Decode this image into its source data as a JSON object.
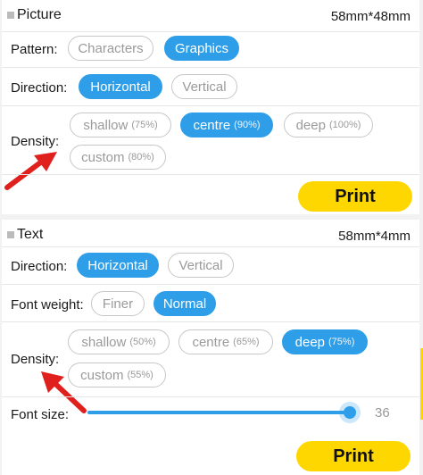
{
  "picture": {
    "title": "Picture",
    "size": "58mm*48mm",
    "pattern": {
      "label": "Pattern:",
      "options": [
        {
          "label": "Characters",
          "selected": false
        },
        {
          "label": "Graphics",
          "selected": true
        }
      ]
    },
    "direction": {
      "label": "Direction:",
      "options": [
        {
          "label": "Horizontal",
          "selected": true
        },
        {
          "label": "Vertical",
          "selected": false
        }
      ]
    },
    "density": {
      "label": "Density:",
      "options": [
        {
          "label": "shallow",
          "percent": "(75%)",
          "selected": false
        },
        {
          "label": "centre",
          "percent": "(90%)",
          "selected": true
        },
        {
          "label": "deep",
          "percent": "(100%)",
          "selected": false
        },
        {
          "label": "custom",
          "percent": "(80%)",
          "selected": false
        }
      ]
    },
    "print_label": "Print"
  },
  "text": {
    "title": "Text",
    "size": "58mm*4mm",
    "direction": {
      "label": "Direction:",
      "options": [
        {
          "label": "Horizontal",
          "selected": true
        },
        {
          "label": "Vertical",
          "selected": false
        }
      ]
    },
    "font_weight": {
      "label": "Font weight:",
      "options": [
        {
          "label": "Finer",
          "selected": false
        },
        {
          "label": "Normal",
          "selected": true
        }
      ]
    },
    "density": {
      "label": "Density:",
      "options": [
        {
          "label": "shallow",
          "percent": "(50%)",
          "selected": false
        },
        {
          "label": "centre",
          "percent": "(65%)",
          "selected": false
        },
        {
          "label": "deep",
          "percent": "(75%)",
          "selected": true
        },
        {
          "label": "custom",
          "percent": "(55%)",
          "selected": false
        }
      ]
    },
    "font_size": {
      "label": "Font size:",
      "value": "36"
    },
    "print_label": "Print"
  },
  "colors": {
    "accent": "#2f9ee8",
    "print_button": "#ffd700",
    "annotation_arrow": "#e0201c"
  }
}
